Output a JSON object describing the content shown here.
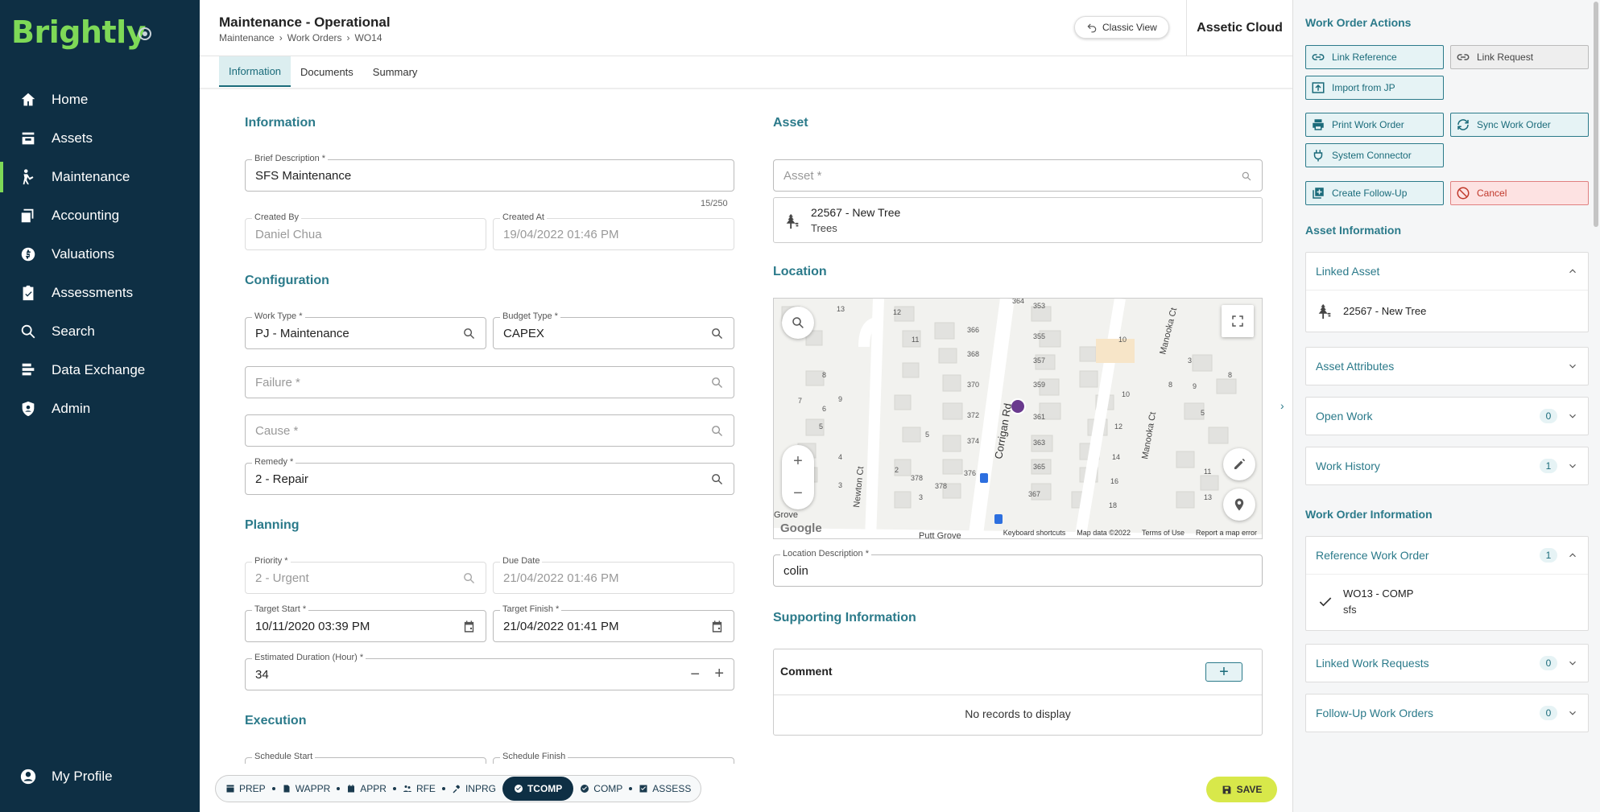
{
  "brand": "Brightly",
  "nav": [
    {
      "label": "Home",
      "icon": "home-icon"
    },
    {
      "label": "Assets",
      "icon": "assets-icon"
    },
    {
      "label": "Maintenance",
      "icon": "maintenance-icon"
    },
    {
      "label": "Accounting",
      "icon": "accounting-icon"
    },
    {
      "label": "Valuations",
      "icon": "valuations-icon"
    },
    {
      "label": "Assessments",
      "icon": "assessments-icon"
    },
    {
      "label": "Search",
      "icon": "search-icon"
    },
    {
      "label": "Data Exchange",
      "icon": "data-exchange-icon"
    },
    {
      "label": "Admin",
      "icon": "admin-icon"
    }
  ],
  "profile_label": "My Profile",
  "header": {
    "title": "Maintenance - Operational",
    "crumbs": [
      "Maintenance",
      "›",
      "Work Orders",
      "›",
      "WO14"
    ],
    "classic_view": "Classic View",
    "org": "Assetic Cloud"
  },
  "tabs": [
    "Information",
    "Documents",
    "Summary"
  ],
  "info": {
    "section": "Information",
    "brief_label": "Brief Description *",
    "brief_value": "SFS Maintenance",
    "brief_count": "15/250",
    "created_by_label": "Created By",
    "created_by_value": "Daniel Chua",
    "created_at_label": "Created At",
    "created_at_value": "19/04/2022 01:46 PM"
  },
  "config": {
    "section": "Configuration",
    "work_type_label": "Work Type *",
    "work_type_value": "PJ - Maintenance",
    "budget_type_label": "Budget Type *",
    "budget_type_value": "CAPEX",
    "failure_ph": "Failure *",
    "cause_ph": "Cause *",
    "remedy_label": "Remedy *",
    "remedy_value": "2 - Repair"
  },
  "planning": {
    "section": "Planning",
    "priority_label": "Priority *",
    "priority_value": "2 - Urgent",
    "due_label": "Due Date",
    "due_value": "21/04/2022 01:46 PM",
    "tstart_label": "Target Start *",
    "tstart_value": "10/11/2020 03:39 PM",
    "tfinish_label": "Target Finish *",
    "tfinish_value": "21/04/2022 01:41 PM",
    "duration_label": "Estimated Duration (Hour) *",
    "duration_value": "34"
  },
  "execution": {
    "section": "Execution",
    "sched_start_label": "Schedule Start",
    "sched_finish_label": "Schedule Finish"
  },
  "asset": {
    "section": "Asset",
    "asset_ph": "Asset *",
    "asset_name": "22567 - New Tree",
    "asset_type": "Trees"
  },
  "location": {
    "section": "Location",
    "desc_label": "Location Description *",
    "desc_value": "colin",
    "map_streets": [
      "Corrigan Rd",
      "Newton Ct",
      "Manooka Ct",
      "Manooka Ct",
      "Putt Grove",
      "Grove"
    ],
    "map_house_numbers": [
      "364",
      "353",
      "13",
      "12",
      "366",
      "355",
      "11",
      "10",
      "368",
      "357",
      "370",
      "359",
      "10",
      "9",
      "372",
      "361",
      "12",
      "374",
      "363",
      "14",
      "376",
      "365",
      "16",
      "378",
      "378",
      "367",
      "18",
      "8",
      "7",
      "6",
      "5",
      "4",
      "3",
      "2",
      "3",
      "5",
      "8",
      "9",
      "11",
      "13",
      "5",
      "3",
      "8"
    ],
    "google": "Google",
    "attrib": [
      "Keyboard shortcuts",
      "Map data ©2022",
      "Terms of Use",
      "Report a map error"
    ]
  },
  "supporting": {
    "section": "Supporting Information",
    "comment_label": "Comment",
    "add": "+",
    "empty": "No records to display"
  },
  "steps": [
    {
      "label": "PREP",
      "active": false
    },
    {
      "label": "WAPPR",
      "active": false
    },
    {
      "label": "APPR",
      "active": false
    },
    {
      "label": "RFE",
      "active": false
    },
    {
      "label": "INPRG",
      "active": false
    },
    {
      "label": "TCOMP",
      "active": true
    },
    {
      "label": "COMP",
      "active": false
    },
    {
      "label": "ASSESS",
      "active": false
    }
  ],
  "save": "SAVE",
  "panel": {
    "actions_title": "Work Order Actions",
    "actions": {
      "link_reference": "Link Reference",
      "link_request": "Link Request",
      "import_jp": "Import from JP",
      "print": "Print Work Order",
      "sync": "Sync Work Order",
      "connector": "System Connector",
      "follow_up": "Create Follow-Up",
      "cancel": "Cancel"
    },
    "asset_info_title": "Asset Information",
    "linked_asset": "Linked Asset",
    "linked_asset_item": "22567 - New Tree",
    "asset_attributes": "Asset Attributes",
    "open_work": "Open Work",
    "open_work_count": "0",
    "work_history": "Work History",
    "work_history_count": "1",
    "wo_info_title": "Work Order Information",
    "ref_wo": "Reference Work Order",
    "ref_wo_count": "1",
    "ref_wo_item_title": "WO13 - COMP",
    "ref_wo_item_sub": "sfs",
    "linked_requests": "Linked Work Requests",
    "linked_requests_count": "0",
    "follow_ups": "Follow-Up Work Orders",
    "follow_ups_count": "0"
  },
  "colors": {
    "sidebar": "#0e2f44",
    "accent": "#2b7a8a",
    "brand": "#7ed957",
    "save": "#d8e84a"
  }
}
